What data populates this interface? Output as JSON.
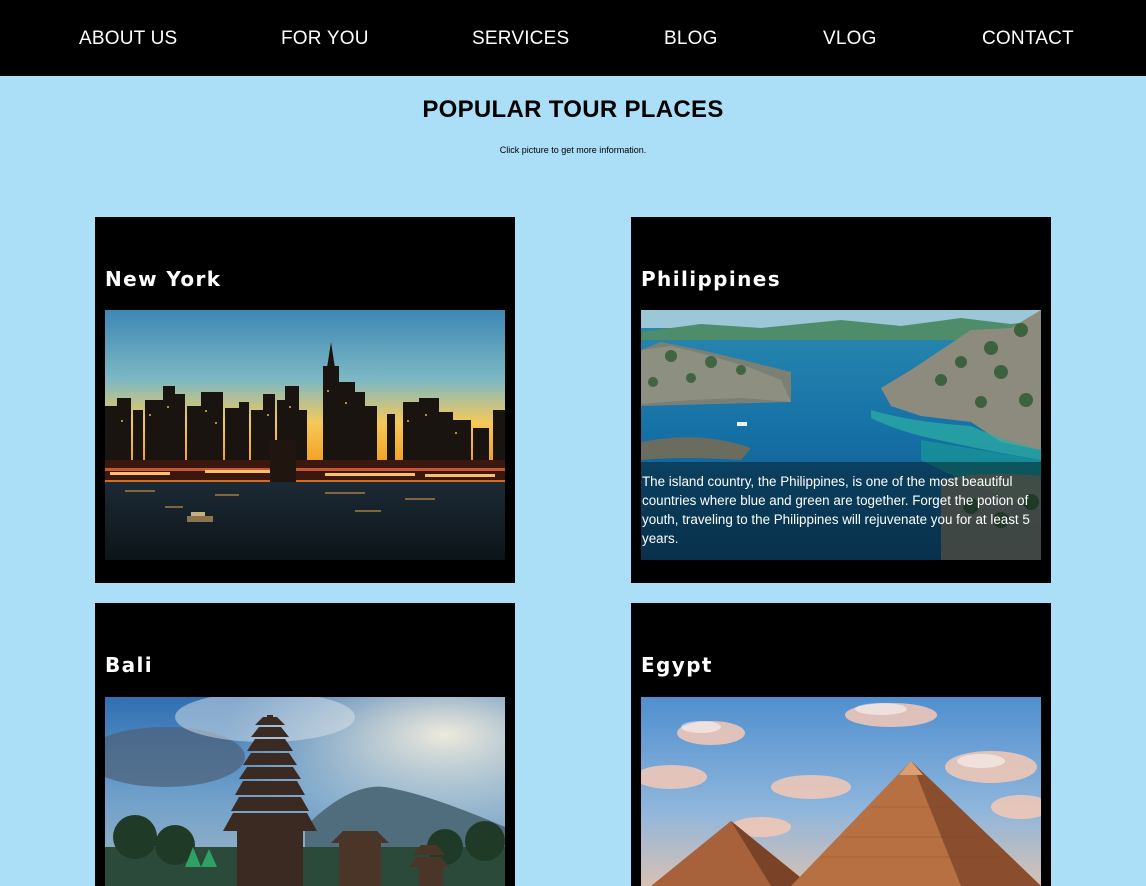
{
  "nav": {
    "items": [
      {
        "label": "ABOUT US"
      },
      {
        "label": "FOR YOU"
      },
      {
        "label": "SERVICES"
      },
      {
        "label": "BLOG"
      },
      {
        "label": "VLOG"
      },
      {
        "label": "CONTACT"
      }
    ]
  },
  "main": {
    "title": "POPULAR TOUR PLACES",
    "subtitle": "Click picture to get more information."
  },
  "cards": [
    {
      "title": "New York",
      "image": "new-york-skyline-at-dusk"
    },
    {
      "title": "Philippines",
      "image": "philippines-island-lagoon",
      "description": "The island country, the Philippines, is one of the most beautiful countries where blue and green are together. Forget the potion of youth, traveling to the Philippines will rejuvenate you for at least 5 years."
    },
    {
      "title": "Bali",
      "image": "bali-temple-with-mountain"
    },
    {
      "title": "Egypt",
      "image": "egypt-pyramids-sky"
    }
  ],
  "colors": {
    "background": "#abdff8",
    "navbar": "#000000",
    "card": "#000000",
    "text_light": "#ffffff"
  }
}
